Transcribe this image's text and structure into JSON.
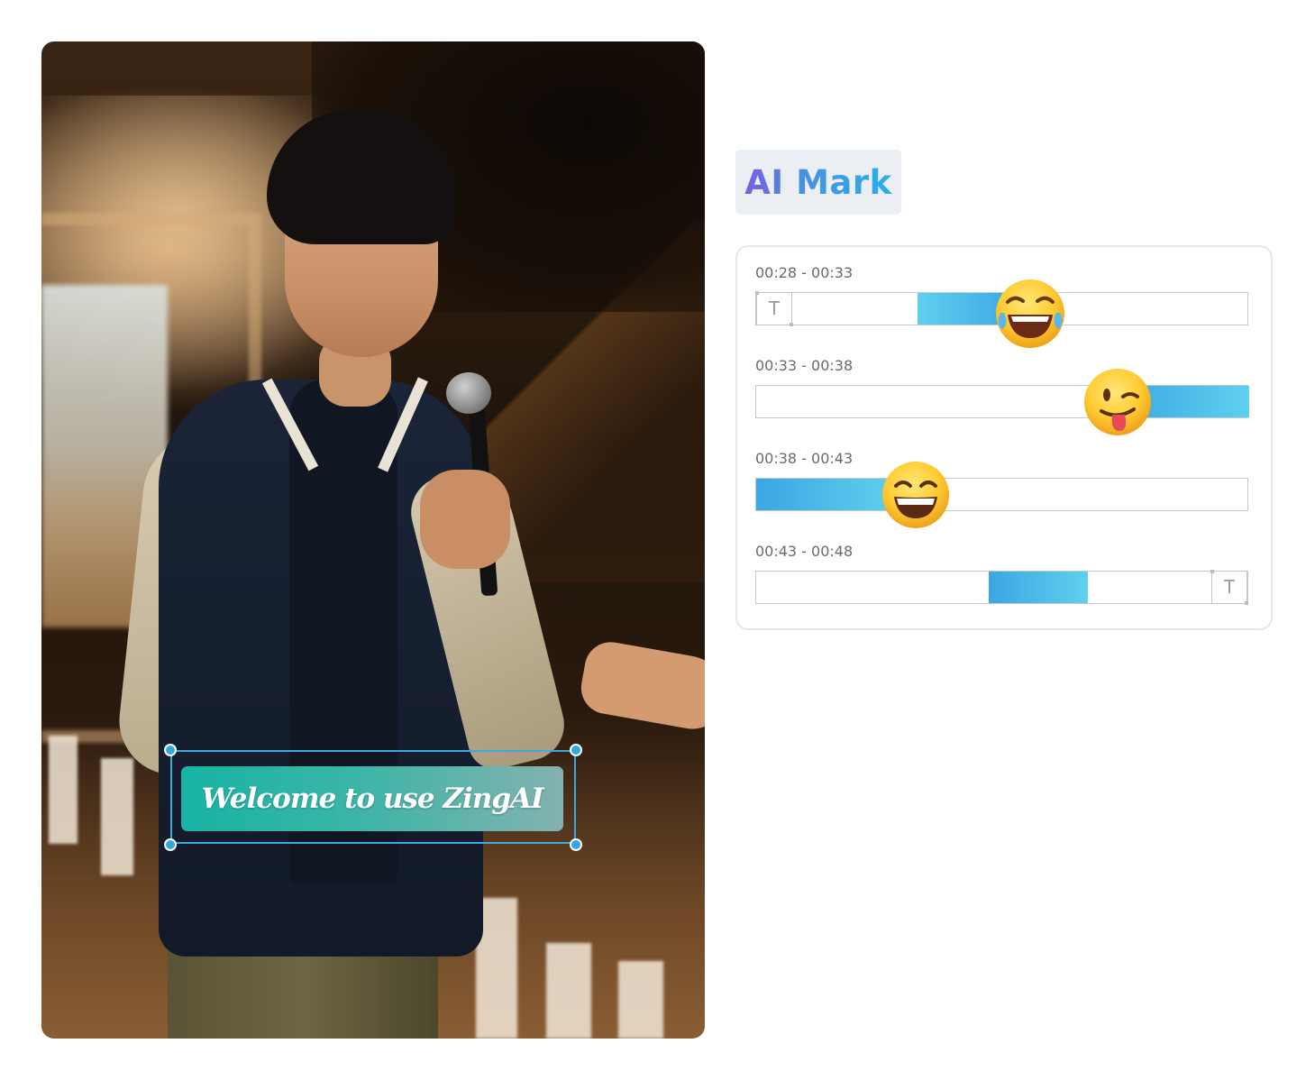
{
  "video": {
    "caption": "Welcome to use ZingAI"
  },
  "badge": {
    "label": "AI Mark"
  },
  "segments": [
    {
      "time_range": "00:28 - 00:33",
      "emoji_icon": "tears-of-joy-emoji",
      "has_text_marker_start": true
    },
    {
      "time_range": "00:33 - 00:38",
      "emoji_icon": "winking-tongue-emoji"
    },
    {
      "time_range": "00:38 - 00:43",
      "emoji_icon": "grinning-emoji"
    },
    {
      "time_range": "00:43 - 00:48",
      "has_text_marker_end": true
    }
  ],
  "text_marker_glyph": "T",
  "colors": {
    "accent": "#33a6e6",
    "caption_start": "#18b4a4",
    "caption_end": "#84b2b0",
    "badge_gradient_start": "#7b5ee0",
    "badge_gradient_end": "#2ab0e8"
  }
}
